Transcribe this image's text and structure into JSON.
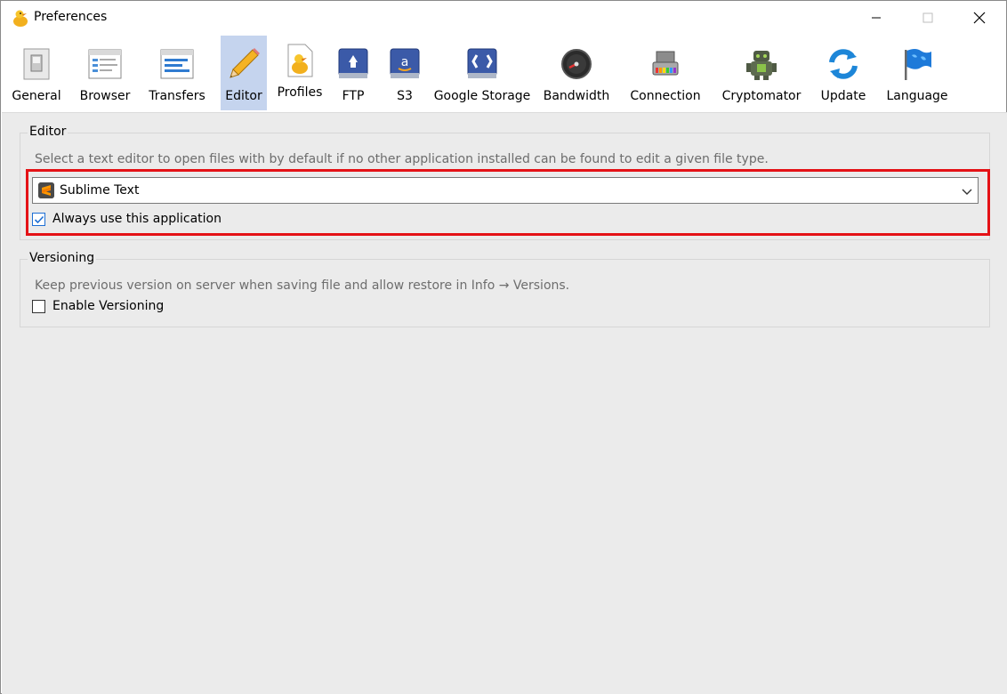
{
  "window": {
    "title": "Preferences",
    "icon": "duck-icon",
    "controls": [
      "minimize-icon",
      "maximize-icon",
      "close-icon"
    ]
  },
  "toolbar": {
    "items": [
      {
        "label": "General",
        "icon": "toggle-switch-icon",
        "selected": false
      },
      {
        "label": "Browser",
        "icon": "browser-window-icon",
        "selected": false
      },
      {
        "label": "Transfers",
        "icon": "transfers-list-icon",
        "selected": false
      },
      {
        "label": "Editor",
        "icon": "pencil-icon",
        "selected": true
      },
      {
        "label": "Profiles",
        "icon": "document-duck-icon",
        "selected": false
      },
      {
        "label": "FTP",
        "icon": "ftp-drive-icon",
        "selected": false
      },
      {
        "label": "S3",
        "icon": "amazon-s3-icon",
        "selected": false
      },
      {
        "label": "Google Storage",
        "icon": "google-storage-icon",
        "selected": false
      },
      {
        "label": "Bandwidth",
        "icon": "gauge-icon",
        "selected": false
      },
      {
        "label": "Connection",
        "icon": "network-adapter-icon",
        "selected": false
      },
      {
        "label": "Cryptomator",
        "icon": "robot-lock-icon",
        "selected": false
      },
      {
        "label": "Update",
        "icon": "refresh-icon",
        "selected": false
      },
      {
        "label": "Language",
        "icon": "flag-icon",
        "selected": false
      }
    ]
  },
  "editor": {
    "group_title": "Editor",
    "description": "Select a text editor to open files with by default if no other application installed can be found to edit a given file type.",
    "selected_editor": "Sublime Text",
    "selected_editor_icon": "sublime-text-icon",
    "always_use_label": "Always use this application",
    "always_use_checked": true
  },
  "versioning": {
    "group_title": "Versioning",
    "description": "Keep previous version on server when saving file and allow restore in Info → Versions.",
    "enable_label": "Enable Versioning",
    "enable_checked": false
  },
  "colors": {
    "selected_tab": "#c5d4ee",
    "highlight": "#e41216",
    "content_bg": "#ebebeb"
  }
}
